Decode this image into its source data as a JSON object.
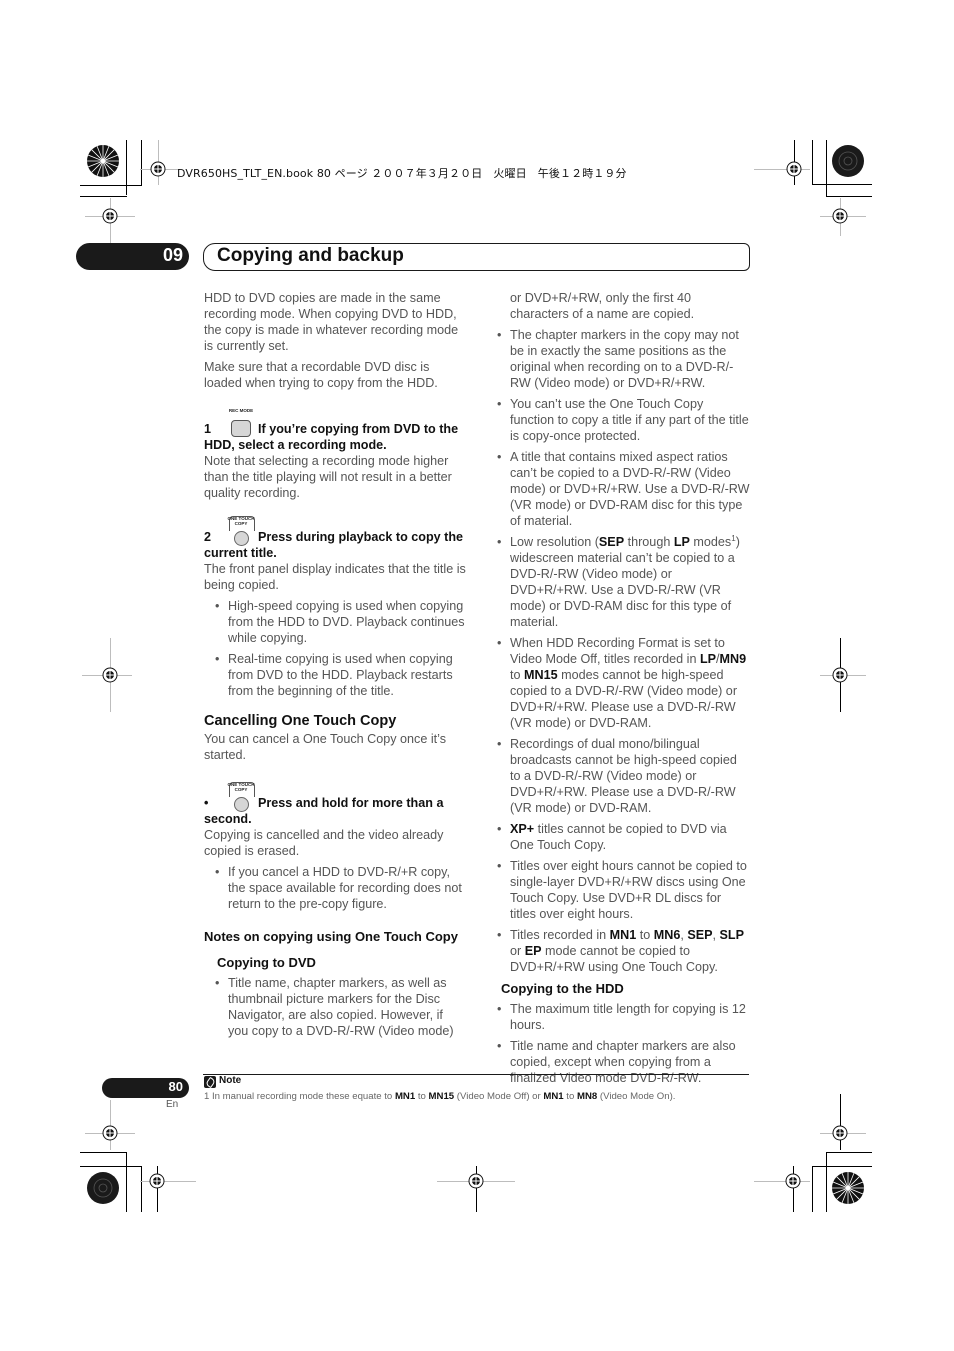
{
  "print_header": "DVR650HS_TLT_EN.book  80 ページ  ２００７年３月２０日　火曜日　午後１２時１９分",
  "chapter": {
    "number": "09",
    "title": "Copying and backup"
  },
  "left_column": {
    "intro_1": "HDD to DVD copies are made in the same recording mode. When copying DVD to HDD, the copy is made in whatever recording mode is currently set.",
    "intro_2": "Make sure that a recordable DVD disc is loaded when trying to copy from the HDD.",
    "step1": {
      "number": "1",
      "button_caption": "REC MODE",
      "title": "If you’re copying from DVD to the HDD, select a recording mode.",
      "body": "Note that selecting a recording mode higher than the title playing will not result in a better quality recording."
    },
    "step2": {
      "number": "2",
      "button_caption": "ONE TOUCH COPY",
      "title": "Press during playback to copy the current title.",
      "body": "The front panel display indicates that the title is being copied.",
      "bullets": [
        "High-speed copying is used when copying from the HDD to DVD. Playback continues while copying.",
        "Real-time copying is used when copying from DVD to the HDD. Playback restarts from the beginning of the title."
      ]
    },
    "cancel_section": {
      "heading": "Cancelling One Touch Copy",
      "intro": "You can cancel a One Touch Copy once it’s started.",
      "button_caption": "ONE TOUCH COPY",
      "step_title": "Press and hold for more than a second.",
      "body": "Copying is cancelled and the video already copied is erased.",
      "bullets": [
        "If you cancel a HDD to DVD-R/+R copy, the space available for recording does not return to the pre-copy figure."
      ]
    },
    "notes_heading": "Notes on copying using One Touch Copy",
    "copying_to_dvd_heading": "Copying to DVD",
    "copying_to_dvd_first_bullet": "Title name, chapter markers, as well as thumbnail picture markers for the Disc Navigator, are also copied. However, if you copy to a DVD-R/-RW (Video mode)"
  },
  "right_column": {
    "continuation": "or DVD+R/+RW, only the first 40 characters of a name are copied.",
    "b_chapter": "The chapter markers in the copy may not be in exactly the same positions as the original when recording on to a DVD-R/-RW (Video mode) or DVD+R/+RW.",
    "b_protected": "You can’t use the One Touch Copy function to copy a title if any part of the title is copy-once protected.",
    "b_aspect": "A title that contains mixed aspect ratios can’t be copied to a DVD-R/-RW (Video mode) or DVD+R/+RW. Use a DVD-R/-RW (VR mode) or DVD-RAM disc for this type of material.",
    "b_lowres": {
      "pre": "Low resolution (",
      "sep": "SEP",
      "mid": " through ",
      "lp": "LP",
      "post1": " modes",
      "sup": "1",
      "post2": ") widescreen material can’t be copied to a DVD-R/-RW (Video mode) or DVD+R/+RW. Use a DVD-R/-RW (VR mode) or DVD-RAM disc for this type of material."
    },
    "b_hddformat": {
      "pre": "When HDD Recording Format is set to Video Mode Off, titles recorded in ",
      "lp": "LP",
      "slash": "/",
      "mn9": "MN9",
      "to": " to ",
      "mn15": "MN15",
      "post": " modes cannot be high-speed copied to a DVD-R/-RW (Video mode) or DVD+R/+RW. Please use a DVD-R/-RW (VR mode) or DVD-RAM."
    },
    "b_dualmono": "Recordings of dual mono/bilingual broadcasts cannot be high-speed copied to a DVD-R/-RW (Video mode) or DVD+R/+RW. Please use a DVD-R/-RW (VR mode) or DVD-RAM.",
    "b_xp": {
      "xp": "XP+",
      "post": " titles cannot be copied to DVD via One Touch Copy."
    },
    "b_eight": "Titles over eight hours cannot be copied to single-layer DVD+R/+RW discs using One Touch Copy. Use DVD+R DL discs for titles over eight hours.",
    "b_modes": {
      "pre": "Titles recorded in ",
      "mn1": "MN1",
      "to": " to ",
      "mn6": "MN6",
      "c1": ", ",
      "sep": "SEP",
      "c2": ", ",
      "slp": "SLP",
      "or": " or ",
      "ep": "EP",
      "post": " mode cannot be copied to DVD+R/+RW using One Touch Copy."
    },
    "copying_to_hdd_heading": "Copying to the HDD",
    "hdd_bullets": [
      "The maximum title length for copying is 12 hours.",
      "Title name and chapter markers are also copied, except when copying from a finalized Video mode DVD-R/-RW."
    ]
  },
  "footer": {
    "page_number": "80",
    "language": "En",
    "note_label": "Note",
    "note": {
      "pre": "1 In manual recording mode these equate to ",
      "a": "MN1",
      "to1": " to ",
      "b": "MN15",
      "mid": " (Video Mode Off) or ",
      "c": "MN1",
      "to2": " to ",
      "d": "MN8",
      "post": " (Video Mode On)."
    }
  }
}
